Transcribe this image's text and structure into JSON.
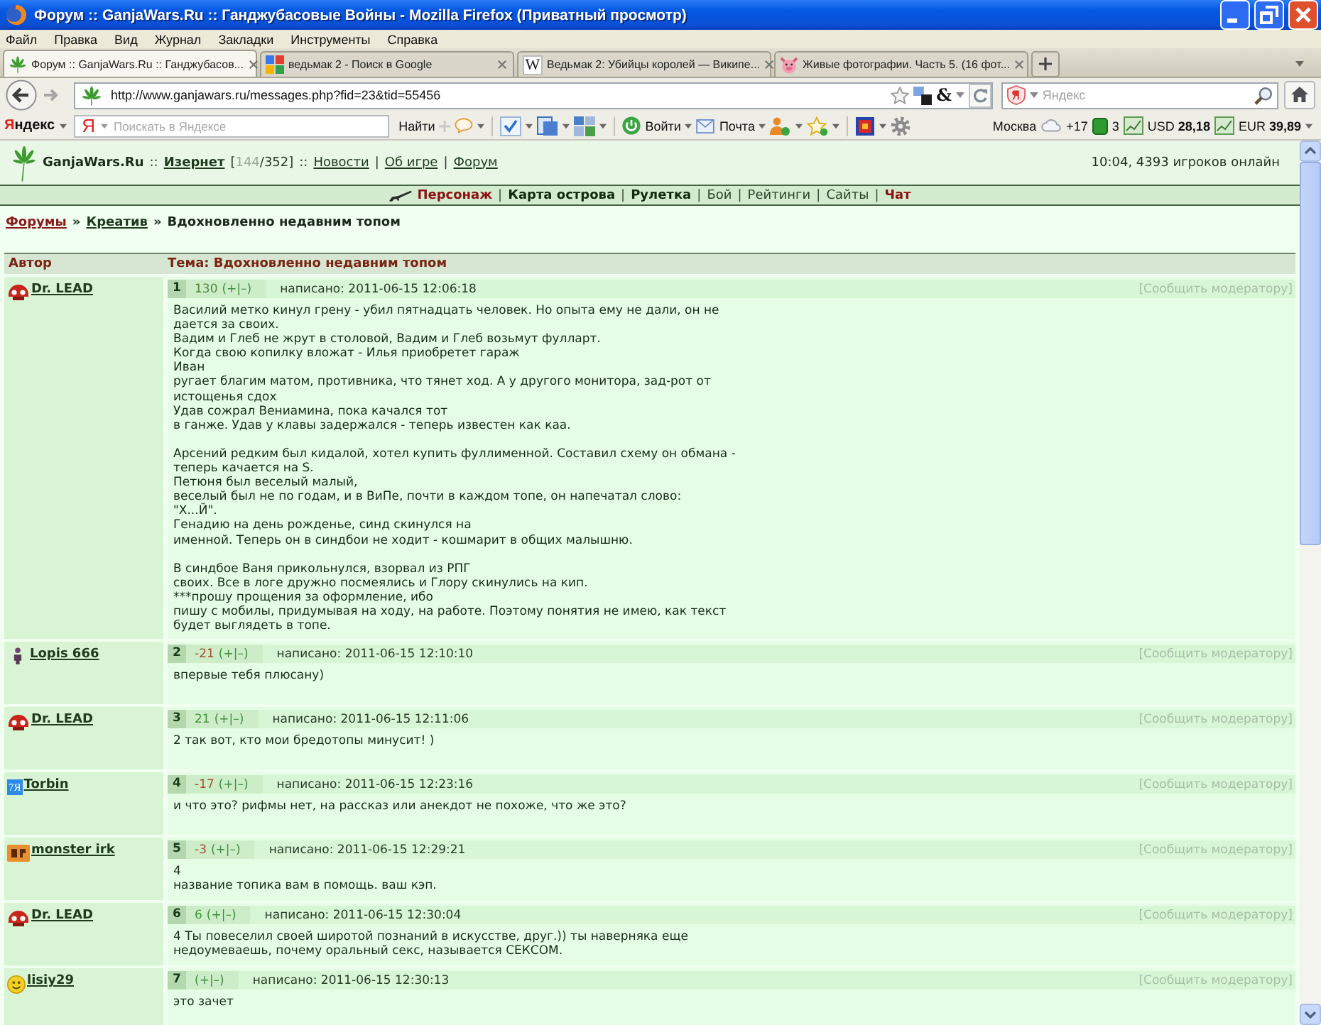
{
  "window": {
    "title": "Форум :: GanjaWars.Ru :: Ганджубасовые Войны - Mozilla Firefox (Приватный просмотр)"
  },
  "menu": [
    "Файл",
    "Правка",
    "Вид",
    "Журнал",
    "Закладки",
    "Инструменты",
    "Справка"
  ],
  "tabs": [
    {
      "label": "Форум :: GanjaWars.Ru :: Ганджубасов...",
      "selected": true,
      "icon": {
        "kind": "leaf"
      }
    },
    {
      "label": "ведьмак 2 - Поиск в Google",
      "selected": false,
      "icon": {
        "kind": "squares"
      }
    },
    {
      "label": "Ведьмак 2: Убийцы королей — Википе...",
      "selected": false,
      "icon": {
        "kind": "letter",
        "text": "W"
      }
    },
    {
      "label": "Живые фотографии. Часть 5. (16 фот...",
      "selected": false,
      "icon": {
        "kind": "pig"
      }
    }
  ],
  "navigation": {
    "url": "http://www.ganjawars.ru/messages.php?fid=23&tid=55456",
    "addon": "&",
    "search_placeholder": "Яндекс"
  },
  "yandex_bar": {
    "logo": "Яндекс",
    "field_mark": "Я",
    "placeholder": "Поискать в Яндексе",
    "find": "Найти",
    "login": "Войти",
    "mail": "Почта",
    "city": "Москва",
    "temperature": "+17",
    "traffic": "3",
    "rates": [
      {
        "currency": "USD",
        "value": "28,18"
      },
      {
        "currency": "EUR",
        "value": "39,89"
      }
    ]
  },
  "site_header": {
    "segments": [
      {
        "kind": "brand",
        "text": "GanjaWars.Ru"
      },
      {
        "kind": "sep",
        "text": "::"
      },
      {
        "kind": "link",
        "text": "Изернет",
        "bold": true
      },
      {
        "kind": "counter",
        "prefix": "[",
        "value": "144",
        "suffix": "/352]"
      },
      {
        "kind": "sep",
        "text": "::"
      },
      {
        "kind": "link",
        "text": "Новости",
        "bold": false
      },
      {
        "kind": "sep",
        "text": "|"
      },
      {
        "kind": "link",
        "text": "Об игре",
        "bold": false
      },
      {
        "kind": "sep",
        "text": "|"
      },
      {
        "kind": "link",
        "text": "Форум",
        "bold": false
      }
    ],
    "status": "10:04, 4393 игроков онлайн"
  },
  "game_nav": [
    {
      "kind": "accent",
      "text": "Персонаж"
    },
    {
      "kind": "sep",
      "text": "|"
    },
    {
      "kind": "strong",
      "text": "Карта острова"
    },
    {
      "kind": "sep",
      "text": "|"
    },
    {
      "kind": "strong",
      "text": "Рулетка"
    },
    {
      "kind": "sep",
      "text": "|"
    },
    {
      "kind": "plain",
      "text": "Бой"
    },
    {
      "kind": "sep",
      "text": "|"
    },
    {
      "kind": "plain",
      "text": "Рейтинги"
    },
    {
      "kind": "sep",
      "text": "|"
    },
    {
      "kind": "plain",
      "text": "Сайты"
    },
    {
      "kind": "sep",
      "text": "|"
    },
    {
      "kind": "accent",
      "text": "Чат"
    }
  ],
  "breadcrumb": [
    {
      "kind": "accent",
      "text": "Форумы"
    },
    {
      "kind": "sep",
      "text": "»"
    },
    {
      "kind": "link",
      "text": "Креатив"
    },
    {
      "kind": "sep",
      "text": "»"
    },
    {
      "kind": "current",
      "text": "Вдохновленно недавним топом"
    }
  ],
  "table": {
    "columns": [
      "Автор",
      "Тема: Вдохновленно недавним топом"
    ]
  },
  "posts": [
    {
      "author": "Dr. LEAD",
      "avatar": {
        "kind": "helmet"
      },
      "number": "1",
      "rating": {
        "text": "130",
        "color": "#4f8a3c"
      },
      "vote": "(+|–)",
      "date": "написано: 2011-06-15 12:06:18",
      "report": "[Сообщить модератору]",
      "body": "Василий метко кинул грену - убил пятнадцать человек. Но опыта ему не дали, он не\nдается за своих.\nВадим и Глеб не жрут в столовой, Вадим и Глеб возьмут фулларт.\nКогда свою копилку вложат - Илья приобретет гараж\nИван\nругает благим матом, противника, что тянет ход. А у другого монитора, зад-рот от\nистощенья сдох\nУдав сожрал Вениамина, пока качался тот\nв ганже. Удав у клавы задержался - теперь известен как каа.\n\nАрсений редким был кидалой, хотел купить фуллименной. Составил схему он обмана -\nтеперь качается на S.\nПетюня был веселый малый,\nвеселый был не по годам, и в ВиПе, почти в каждом топе, он напечатал слово:\n\"Х...Й\".\nГенадию на день рожденье, синд скинулся на\nименной. Теперь он в синдбои не ходит - кошмарит в общих малышню.\n\nВ синдбое Ваня прикольнулся, взорвал из РПГ\nсвоих. Все в логе дружно посмеялись и Глору скинулись на кип.\n***прошу прощения за оформление, ибо\nпишу с мобилы, придумывая на ходу, на работе. Поэтому понятия не имею, как текст\nбудет выглядеть в топе."
    },
    {
      "author": "Lopis 666",
      "avatar": {
        "kind": "figure"
      },
      "number": "2",
      "rating": {
        "text": "-21",
        "color": "#a3502c"
      },
      "vote": "(+|–)",
      "date": "написано: 2011-06-15 12:10:10",
      "report": "[Сообщить модератору]",
      "body": "впервые тебя плюсану)"
    },
    {
      "author": "Dr. LEAD",
      "avatar": {
        "kind": "helmet"
      },
      "number": "3",
      "rating": {
        "text": "21",
        "color": "#3f9a34"
      },
      "vote": "(+|–)",
      "date": "написано: 2011-06-15 12:11:06",
      "report": "[Сообщить модератору]",
      "body": "2 так вот, кто мои бредотопы минусит! )"
    },
    {
      "author": "Torbin",
      "avatar": {
        "kind": "badge",
        "text": "7Я"
      },
      "number": "4",
      "rating": {
        "text": "-17",
        "color": "#a3502c"
      },
      "vote": "(+|–)",
      "date": "написано: 2011-06-15 12:23:16",
      "report": "[Сообщить модератору]",
      "body": "и что это? рифмы нет, на рассказ или анекдот не похоже, что же это?"
    },
    {
      "author": "monster irk",
      "avatar": {
        "kind": "tile"
      },
      "number": "5",
      "rating": {
        "text": "-3",
        "color": "#a3502c"
      },
      "vote": "(+|–)",
      "date": "написано: 2011-06-15 12:29:21",
      "report": "[Сообщить модератору]",
      "body": "4\nназвание топика вам в помощь. ваш кэп."
    },
    {
      "author": "Dr. LEAD",
      "avatar": {
        "kind": "helmet"
      },
      "number": "6",
      "rating": {
        "text": "6",
        "color": "#3f9a34"
      },
      "vote": "(+|–)",
      "date": "написано: 2011-06-15 12:30:04",
      "report": "[Сообщить модератору]",
      "body": "4 Ты повеселил своей широтой познаний в искусстве, друг.)) ты наверняка еще\nнедоумеваешь, почему оральный секс, называется СЕКСОМ."
    },
    {
      "author": "lisiy29",
      "avatar": {
        "kind": "smiley"
      },
      "number": "7",
      "vote": "(+|–)",
      "date": "написано: 2011-06-15 12:30:13",
      "report": "[Сообщить модератору]",
      "body": "это зачет"
    }
  ]
}
